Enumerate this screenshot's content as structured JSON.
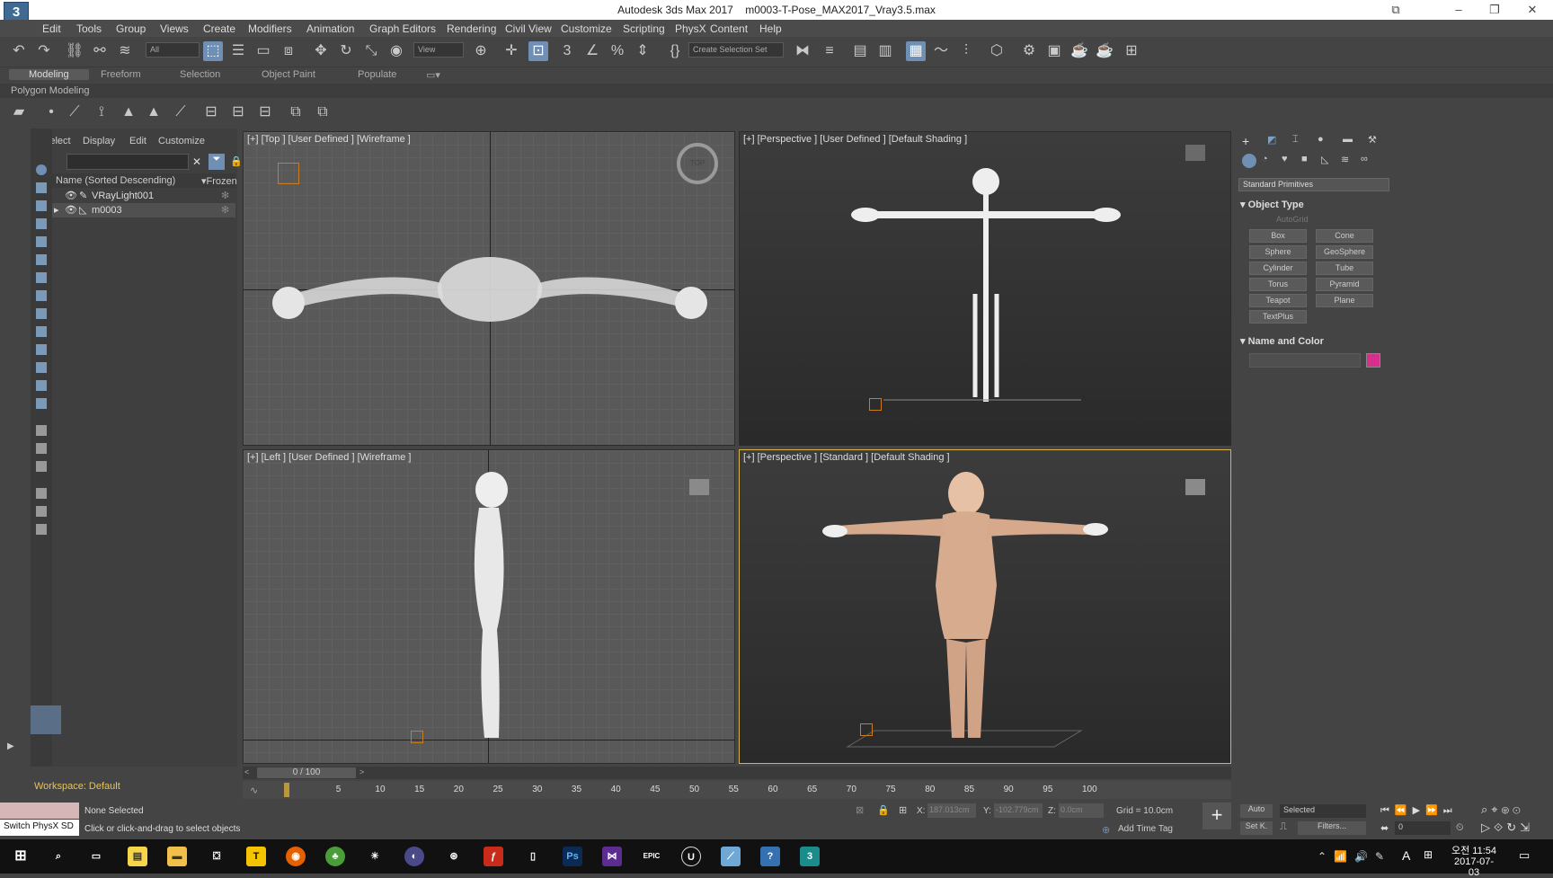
{
  "window": {
    "app_title": "Autodesk 3ds Max 2017",
    "file_name": "m0003-T-Pose_MAX2017_Vray3.5.max",
    "logo": "3"
  },
  "menu": [
    "Edit",
    "Tools",
    "Group",
    "Views",
    "Create",
    "Modifiers",
    "Animation",
    "Graph Editors",
    "Rendering",
    "Civil View",
    "Customize",
    "Scripting",
    "PhysX",
    "Content",
    "Help"
  ],
  "toolbar": {
    "filter_value": "All",
    "view_value": "View",
    "selection_set": "Create Selection Set"
  },
  "ribbon": {
    "tabs": [
      "Modeling",
      "Freeform",
      "Selection",
      "Object Paint",
      "Populate"
    ],
    "sub": "Polygon Modeling"
  },
  "scene_explorer": {
    "tabs": [
      "Select",
      "Display",
      "Edit",
      "Customize"
    ],
    "column": "Name (Sorted Descending)",
    "frozen": "Frozen",
    "items": [
      "VRayLight001",
      "m0003"
    ],
    "workspace": "Workspace: Default"
  },
  "viewports": {
    "top": "[+] [Top ] [User Defined ] [Wireframe ]",
    "persp1": "[+] [Perspective ] [User Defined ] [Default Shading ]",
    "left": "[+] [Left ] [User Defined ] [Wireframe ]",
    "persp2": "[+] [Perspective ] [Standard ] [Default Shading ]",
    "nav_top": "TOP"
  },
  "command_panel": {
    "category": "Standard Primitives",
    "object_type": "Object Type",
    "autogrid": "AutoGrid",
    "buttons": [
      "Box",
      "Cone",
      "Sphere",
      "GeoSphere",
      "Cylinder",
      "Tube",
      "Torus",
      "Pyramid",
      "Teapot",
      "Plane",
      "TextPlus"
    ],
    "name_color": "Name and Color",
    "swatch": "#d6308c"
  },
  "timeline": {
    "slider": "0 / 100",
    "ticks": [
      "5",
      "10",
      "15",
      "20",
      "25",
      "30",
      "35",
      "40",
      "45",
      "50",
      "55",
      "60",
      "65",
      "70",
      "75",
      "80",
      "85",
      "90",
      "95",
      "100"
    ],
    "frame_position": 0.0
  },
  "status": {
    "selection": "None Selected",
    "prompt": "Click or click-and-drag to select objects",
    "maxscript": "Switch PhysX SD",
    "x_label": "X:",
    "x_val": "187.013cm",
    "y_label": "Y:",
    "y_val": "-102.779cm",
    "z_label": "Z:",
    "z_val": "0.0cm",
    "grid": "Grid = 10.0cm",
    "add_time_tag": "Add Time Tag",
    "auto": "Auto",
    "set_key": "Set K.",
    "selected_dd": "Selected",
    "filters": "Filters...",
    "frame_field": "0"
  },
  "taskbar": {
    "time": "오전 11:54",
    "date": "2017-07-03",
    "ime": "A"
  }
}
